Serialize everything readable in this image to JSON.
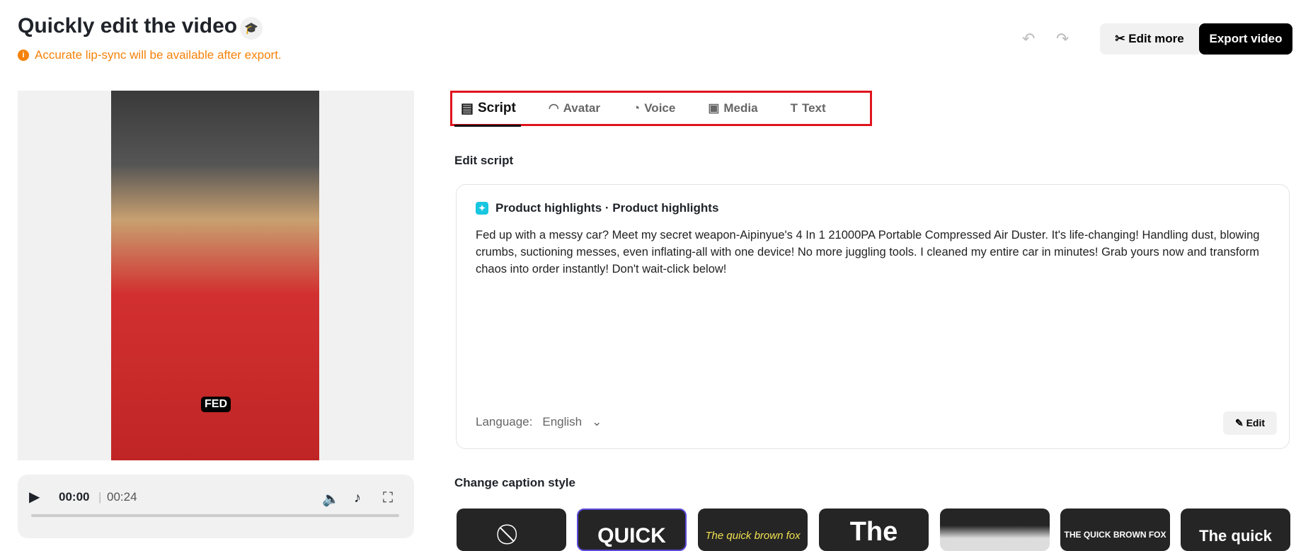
{
  "header": {
    "title": "Quickly edit the video",
    "notice": "Accurate lip-sync will be available after export.",
    "edit_more": "Edit more",
    "export": "Export video"
  },
  "player": {
    "caption": "FED",
    "current_time": "00:00",
    "duration": "00:24",
    "progress": 0
  },
  "tabs": [
    {
      "label": "Script",
      "icon": "script-icon"
    },
    {
      "label": "Avatar",
      "icon": "avatar-icon"
    },
    {
      "label": "Voice",
      "icon": "voice-icon"
    },
    {
      "label": "Media",
      "icon": "media-icon"
    },
    {
      "label": "Text",
      "icon": "text-icon"
    }
  ],
  "script": {
    "section_label": "Edit script",
    "heading": "Product highlights · Product highlights",
    "body": "Fed up with a messy car? Meet my secret weapon-Aipinyue's 4 In 1 21000PA Portable Compressed Air Duster. It's life-changing! Handling dust, blowing crumbs, suctioning messes, even inflating-all with one device! No more juggling tools. I cleaned my entire car in minutes! Grab yours now and transform chaos into order instantly! Don't wait-click below!",
    "language_label": "Language:",
    "language": "English",
    "edit": "Edit"
  },
  "captions": {
    "label": "Change caption style",
    "styles": [
      "⃠",
      "QUICK",
      "The quick brown fox",
      "The",
      "",
      "THE QUICK BROWN FOX",
      "The quick"
    ]
  }
}
